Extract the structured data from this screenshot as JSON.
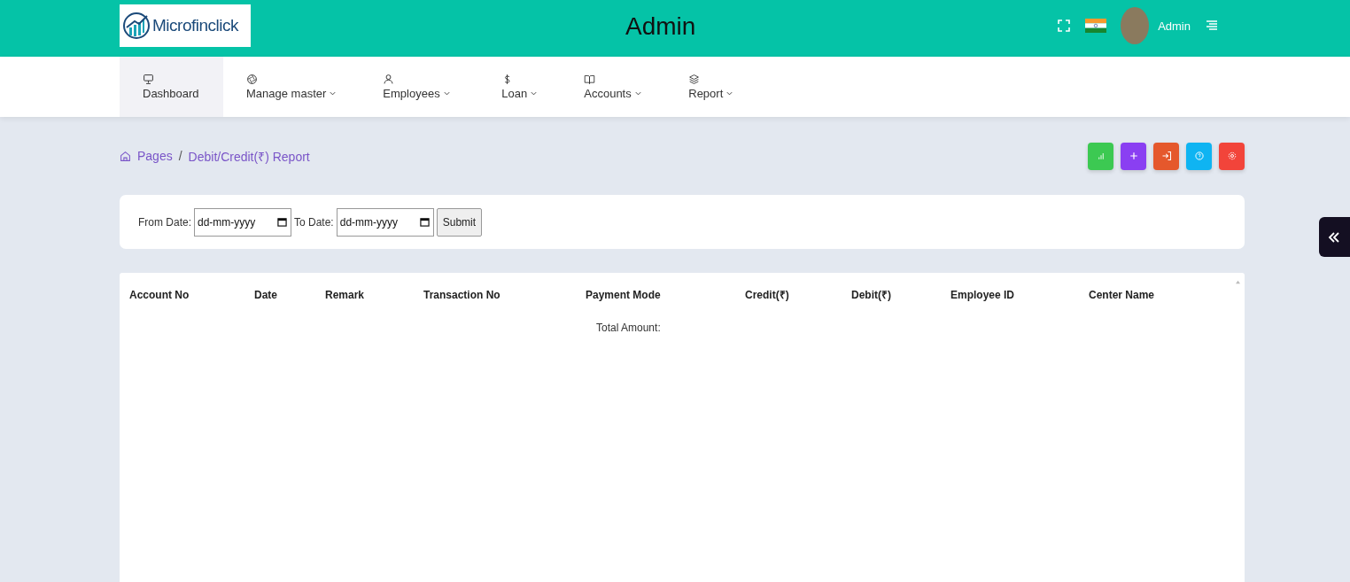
{
  "header": {
    "logo_text": "Microfinclick",
    "title": "Admin",
    "user_name": "Admin"
  },
  "nav": [
    {
      "label": "Dashboard",
      "dropdown": false,
      "selected": true
    },
    {
      "label": "Manage master",
      "dropdown": true,
      "selected": false
    },
    {
      "label": "Employees",
      "dropdown": true,
      "selected": false
    },
    {
      "label": "Loan",
      "dropdown": true,
      "selected": false
    },
    {
      "label": "Accounts",
      "dropdown": true,
      "selected": false
    },
    {
      "label": "Report",
      "dropdown": true,
      "selected": false
    }
  ],
  "breadcrumb": [
    "Pages",
    "Debit/Credit(₹) Report"
  ],
  "breadcrumb_separator": "/",
  "action_buttons": [
    {
      "kind": "chart",
      "color": "#3cc952"
    },
    {
      "kind": "plus",
      "color": "#8a3ff2"
    },
    {
      "kind": "login",
      "color": "#e5582c"
    },
    {
      "kind": "help",
      "color": "#0fb4f2"
    },
    {
      "kind": "settings",
      "color": "#f2443a"
    }
  ],
  "filter": {
    "from_label": "From Date:",
    "from_placeholder": "dd-mm-yyyy",
    "to_label": "To Date:",
    "to_placeholder": "dd-mm-yyyy",
    "submit": "Submit"
  },
  "table": {
    "columns": [
      "Account No",
      "Date",
      "Remark",
      "Transaction No",
      "Payment Mode",
      "Credit(₹)",
      "Debit(₹)",
      "Employee ID",
      "Center Name"
    ],
    "total_label": "Total Amount:"
  }
}
